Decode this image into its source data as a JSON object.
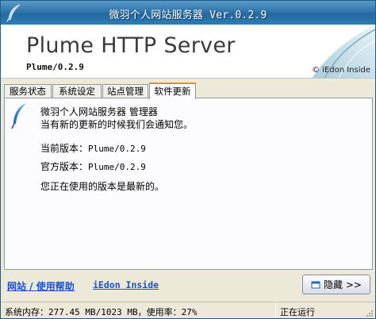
{
  "window": {
    "title": "微羽个人网站服务器 Ver.0.2.9"
  },
  "banner": {
    "brand": "Plume HTTP Server",
    "version": "Plume/0.2.9",
    "copyright": "© iEdon Inside"
  },
  "tabs": [
    {
      "label": "服务状态",
      "active": false
    },
    {
      "label": "系统设定",
      "active": false
    },
    {
      "label": "站点管理",
      "active": false
    },
    {
      "label": "软件更新",
      "active": true
    }
  ],
  "update_panel": {
    "app_name": "微羽个人网站服务器 管理器",
    "notice": "当有新的更新的时候我们会通知您。",
    "current_version_label": "当前版本：",
    "current_version_value": "Plume/0.2.9",
    "official_version_label": "官方版本：",
    "official_version_value": "Plume/0.2.9",
    "status_message": "您正在使用的版本是最新的。"
  },
  "footer": {
    "link_site_help": "网站 / 使用帮助",
    "link_iedon": "iEdon Inside",
    "hide_button_label": "隐藏 >>"
  },
  "statusbar": {
    "memory": "系统内存：277.45 MB/1023 MB，使用率：27%",
    "state": "正在运行"
  },
  "colors": {
    "titlebar": "#2e76ad",
    "link": "#1a4fd6",
    "active_tab_accent": "#e68b2c"
  },
  "icons": {
    "app": "feather-icon",
    "panel": "feather-icon",
    "hide_button": "hide-window-icon"
  }
}
